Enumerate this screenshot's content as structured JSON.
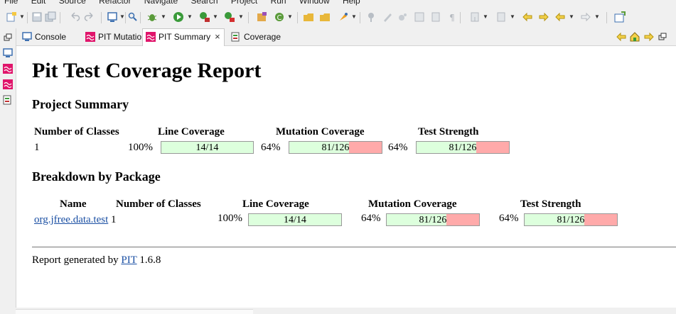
{
  "menu": [
    "File",
    "Edit",
    "Source",
    "Refactor",
    "Navigate",
    "Search",
    "Project",
    "Run",
    "Window",
    "Help"
  ],
  "tabs": [
    {
      "label": "Console",
      "icon": "console-icon",
      "active": false
    },
    {
      "label": "PIT Mutations",
      "icon": "pit-icon",
      "active": false
    },
    {
      "label": "PIT Summary",
      "icon": "pit-icon",
      "active": true,
      "close": "×"
    },
    {
      "label": "Coverage",
      "icon": "coverage-icon",
      "active": false
    }
  ],
  "report": {
    "title": "Pit Test Coverage Report",
    "project_summary": {
      "heading": "Project Summary",
      "headers": {
        "classes": "Number of Classes",
        "line": "Line Coverage",
        "mutation": "Mutation Coverage",
        "strength": "Test Strength"
      },
      "row": {
        "classes": "1",
        "line_pct": "100%",
        "line_ratio": "14/14",
        "line_fill": 1.0,
        "mutation_pct": "64%",
        "mutation_ratio": "81/126",
        "mutation_fill": 0.643,
        "strength_pct": "64%",
        "strength_ratio": "81/126",
        "strength_fill": 0.643
      }
    },
    "breakdown": {
      "heading": "Breakdown by Package",
      "headers": {
        "name": "Name",
        "classes": "Number of Classes",
        "line": "Line Coverage",
        "mutation": "Mutation Coverage",
        "strength": "Test Strength"
      },
      "rows": [
        {
          "name": "org.jfree.data.test",
          "classes": "1",
          "line_pct": "100%",
          "line_ratio": "14/14",
          "line_fill": 1.0,
          "mutation_pct": "64%",
          "mutation_ratio": "81/126",
          "mutation_fill": 0.643,
          "strength_pct": "64%",
          "strength_ratio": "81/126",
          "strength_fill": 0.643
        }
      ]
    },
    "footer": {
      "prefix": "Report generated by",
      "link": "PIT",
      "version": "1.6.8"
    }
  },
  "colors": {
    "covered": "#ddffdd",
    "uncovered": "#ffaaaa",
    "link": "#1a4fa3",
    "pit_icon": "#e0156b"
  }
}
